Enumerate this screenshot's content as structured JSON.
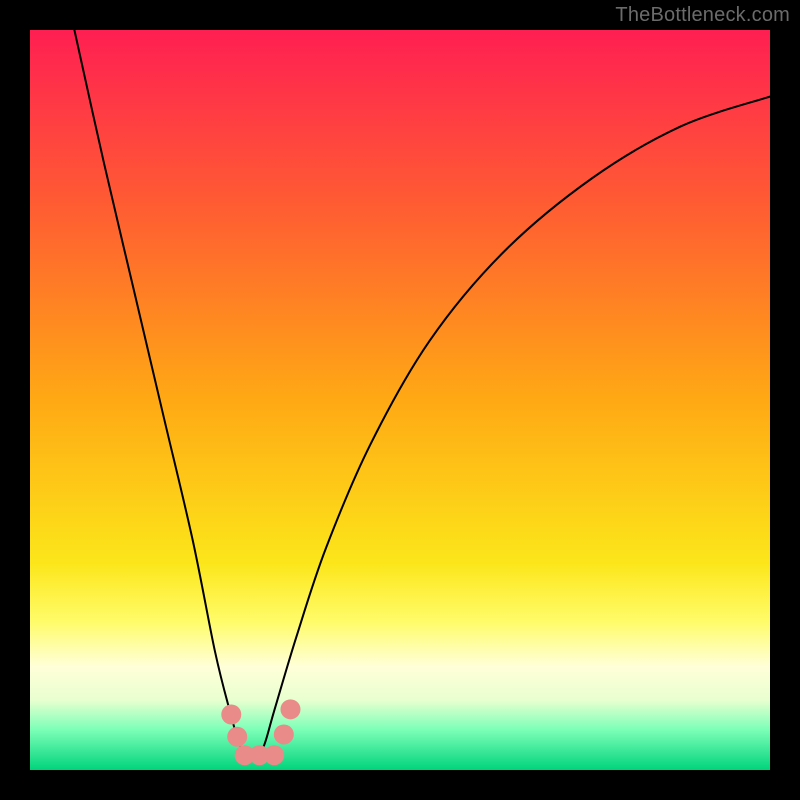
{
  "watermark": "TheBottleneck.com",
  "chart_data": {
    "type": "line",
    "title": "",
    "xlabel": "",
    "ylabel": "",
    "xlim": [
      0,
      100
    ],
    "ylim": [
      0,
      100
    ],
    "grid": false,
    "legend": false,
    "background_gradient": {
      "stops": [
        {
          "offset": 0.0,
          "color": "#ff1f52"
        },
        {
          "offset": 0.24,
          "color": "#ff5d32"
        },
        {
          "offset": 0.5,
          "color": "#ffa914"
        },
        {
          "offset": 0.72,
          "color": "#fce61a"
        },
        {
          "offset": 0.8,
          "color": "#fffc6a"
        },
        {
          "offset": 0.86,
          "color": "#ffffd8"
        },
        {
          "offset": 0.905,
          "color": "#e9ffd0"
        },
        {
          "offset": 0.945,
          "color": "#7dffb8"
        },
        {
          "offset": 1.0,
          "color": "#00d47c"
        }
      ]
    },
    "series": [
      {
        "name": "bottleneck-curve",
        "color": "#000000",
        "stroke_width": 2,
        "x": [
          6,
          10,
          14,
          18,
          22,
          25,
          27,
          28.5,
          30,
          31.5,
          33,
          36,
          40,
          46,
          54,
          64,
          76,
          88,
          100
        ],
        "values": [
          100,
          82,
          65,
          48,
          31,
          16,
          8,
          3,
          1.5,
          3,
          8,
          18,
          30,
          44,
          58,
          70,
          80,
          87,
          91
        ]
      }
    ],
    "markers": {
      "name": "highlight-dots",
      "color": "#e98b88",
      "radius": 10,
      "points": [
        {
          "x": 27.2,
          "y": 7.5
        },
        {
          "x": 28.0,
          "y": 4.5
        },
        {
          "x": 29.0,
          "y": 2.0
        },
        {
          "x": 31.0,
          "y": 2.0
        },
        {
          "x": 33.0,
          "y": 2.0
        },
        {
          "x": 34.3,
          "y": 4.8
        },
        {
          "x": 35.2,
          "y": 8.2
        }
      ]
    }
  }
}
